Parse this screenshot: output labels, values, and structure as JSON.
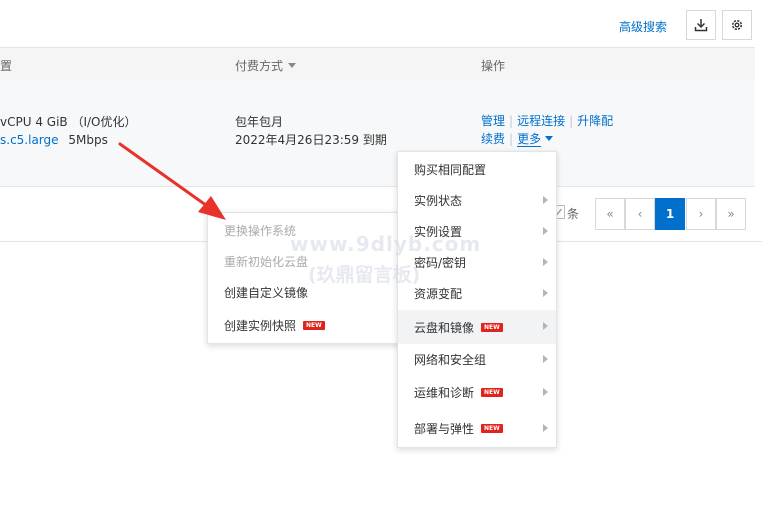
{
  "toolbar": {
    "advanced_search": "高级搜索",
    "download_icon": "download-icon",
    "settings_icon": "gear-icon"
  },
  "table": {
    "headers": {
      "config": "置",
      "billing": "付费方式",
      "ops": "操作"
    },
    "row": {
      "spec": "vCPU 4 GiB （I/O优化）",
      "instance_type": "s.c5.large",
      "bandwidth": "5Mbps",
      "billing_type": "包年包月",
      "expiry": "2022年4月26日23:59 到期",
      "ops": {
        "manage": "管理",
        "remote": "远程连接",
        "upgrade": "升降配",
        "renew": "续费",
        "more": "更多"
      }
    }
  },
  "pagination": {
    "count_suffix": "条",
    "first": "«",
    "prev": "‹",
    "current": "1",
    "next": "›",
    "last": "»"
  },
  "main_menu": {
    "items": [
      {
        "label": "购买相同配置",
        "submenu": false,
        "badge": ""
      },
      {
        "label": "实例状态",
        "submenu": true,
        "badge": ""
      },
      {
        "label": "实例设置",
        "submenu": true,
        "badge": ""
      },
      {
        "label": "密码/密钥",
        "submenu": true,
        "badge": ""
      },
      {
        "label": "资源变配",
        "submenu": true,
        "badge": ""
      },
      {
        "label": "云盘和镜像",
        "submenu": true,
        "badge": "NEW"
      },
      {
        "label": "网络和安全组",
        "submenu": true,
        "badge": ""
      },
      {
        "label": "运维和诊断",
        "submenu": true,
        "badge": "NEW"
      },
      {
        "label": "部署与弹性",
        "submenu": true,
        "badge": "NEW"
      }
    ]
  },
  "sub_menu": {
    "items": [
      {
        "label": "更换操作系统",
        "disabled": true,
        "badge": ""
      },
      {
        "label": "重新初始化云盘",
        "disabled": true,
        "badge": ""
      },
      {
        "label": "创建自定义镜像",
        "disabled": false,
        "badge": ""
      },
      {
        "label": "创建实例快照",
        "disabled": false,
        "badge": "NEW"
      }
    ]
  },
  "watermark": {
    "line1": "www.9dlyb.com",
    "line2": "(玖鼎留言板)"
  },
  "colors": {
    "link": "#0070cc",
    "badge": "#e0241b",
    "arrow": "#e8322c"
  }
}
